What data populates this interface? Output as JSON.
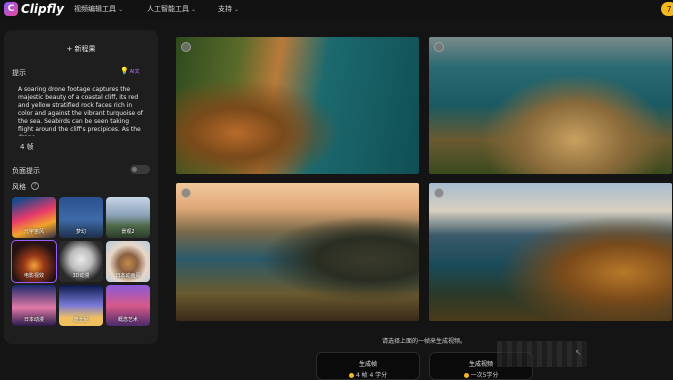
{
  "header": {
    "logo_glyph": "C",
    "brand": "Clipfly",
    "nav": [
      {
        "label": "视频编辑工具"
      },
      {
        "label": "人工智能工具"
      },
      {
        "label": "支持"
      }
    ],
    "credits": "7"
  },
  "panel": {
    "new_project": "+ 新程果",
    "prompt_label": "提示",
    "prompt_tools_icon": "bulb-icon",
    "prompt_tools_ai": "AI文",
    "prompt_text": "A soaring drone footage captures the majestic beauty of a coastal cliff, its red and yellow stratified rock faces rich in color and against the vibrant turquoise of the sea. Seabirds can be seen taking flight around the cliff's precipices. As the drone",
    "prompt_count": "4 帧",
    "negative_label": "负面提示",
    "negative_enabled": false,
    "style_label": "风格",
    "help_glyph": "?",
    "styles": [
      {
        "label": "元宇宙风",
        "selected": false
      },
      {
        "label": "梦幻",
        "selected": false
      },
      {
        "label": "景观2",
        "selected": false
      },
      {
        "label": "电影视效",
        "selected": true
      },
      {
        "label": "3D动漫",
        "selected": false
      },
      {
        "label": "日本动画风",
        "selected": false
      },
      {
        "label": "日本动漫",
        "selected": false
      },
      {
        "label": "迪士尼",
        "selected": false
      },
      {
        "label": "概念艺术",
        "selected": false
      }
    ]
  },
  "main": {
    "hint": "请选择上面的一帧来生成视频。",
    "buttons": [
      {
        "title": "生成帧",
        "cost": "4 帧 4 学分"
      },
      {
        "title": "生成视频",
        "cost": "一次5学分"
      }
    ]
  },
  "colors": {
    "accent": "#9b5cff",
    "coin": "#f5b820",
    "background": "#141414",
    "panel": "#1e1e1e"
  }
}
